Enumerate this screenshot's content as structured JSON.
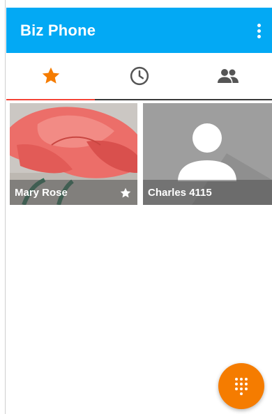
{
  "app": {
    "title": "Biz Phone"
  },
  "colors": {
    "appbar": "#03a9f4",
    "accent": "#f57c00",
    "tab_indicator": "#f44336"
  },
  "tabs": [
    {
      "icon": "star-icon",
      "selected": true
    },
    {
      "icon": "clock-icon",
      "selected": false
    },
    {
      "icon": "contacts-icon",
      "selected": false
    }
  ],
  "favorites": [
    {
      "name": "Mary Rose",
      "starred": true,
      "image": "rose-photo"
    },
    {
      "name": "Charles 4115",
      "starred": false,
      "image": "default-avatar"
    }
  ],
  "fab": {
    "icon": "dialpad-icon"
  }
}
